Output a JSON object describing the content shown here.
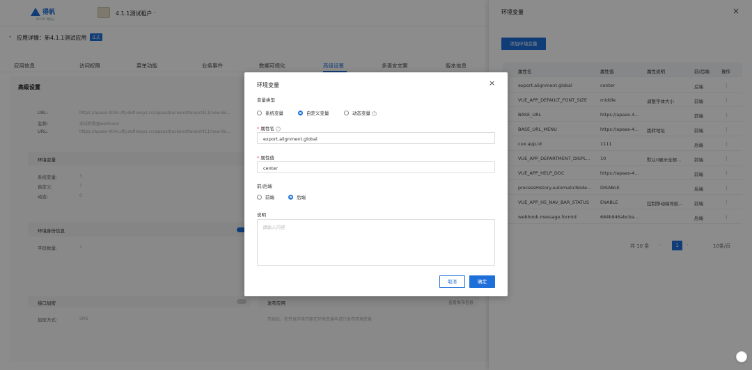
{
  "brand": {
    "logo_text": "得帆",
    "logo_sub": "DEFAN 得帆云",
    "tenant": "4.1.1测试租户"
  },
  "app": {
    "back_label": "‹",
    "title": "应用详情：新4.1.1测试应用",
    "badge": "正式"
  },
  "tabs": [
    "应用信息",
    "访问权限",
    "菜单功能",
    "业务事件",
    "数据可视化",
    "高级设置",
    "多语言文案",
    "版本信息"
  ],
  "card": {
    "title": "高级设置",
    "info": [
      {
        "k": "URL:",
        "v": "https://apaas-404n.dfy.definesys.cn/apaas/backend/tenant411/new-8u..."
      },
      {
        "k": "名称:",
        "v": "测试新数据webhook"
      },
      {
        "k": "URL:",
        "v": "https://apaas-404n.dfy.definesys.cn/apaas/backend/tenant411/new-8u..."
      }
    ],
    "env_title": "环境变量",
    "env": [
      {
        "k": "系统变量:",
        "v": "3"
      },
      {
        "k": "自定义:",
        "v": "7"
      },
      {
        "k": "动态:",
        "v": "0"
      }
    ],
    "identity_title": "环境身份信息",
    "identity": [
      {
        "k": "字段数量:",
        "v": "7"
      }
    ],
    "api_title": "接口加密",
    "api": [
      {
        "k": "加密方式:",
        "v": "SM2"
      }
    ],
    "publish_title": "发布应用",
    "publish_link": "查看发布信息",
    "publish_desc": "开启后，在开发环境只能在环境变量中进行发布环境变量"
  },
  "drawer": {
    "title": "环境变量",
    "close": "×",
    "add_button": "添加环境变量",
    "columns": [
      "属性名",
      "属性值",
      "属性说明",
      "前/后端",
      "操作"
    ],
    "rows": [
      {
        "name": "export.alignment.global",
        "value": "center",
        "desc": "",
        "side": "后端"
      },
      {
        "name": "VUE_APP_DEFAULT_FONT_SIZE",
        "value": "middle",
        "desc": "调整字体大小",
        "side": "前端"
      },
      {
        "name": "BASE_URL",
        "value": "https://apaas-4...",
        "desc": "",
        "side": "前端"
      },
      {
        "name": "BASE_URL_MENU",
        "value": "https://apaas-4...",
        "desc": "跳转地址",
        "side": "前端"
      },
      {
        "name": "cux.app.id",
        "value": "1111",
        "desc": "",
        "side": "后端"
      },
      {
        "name": "VUE_APP_DEPARTMENT_DISPL...",
        "value": "10",
        "desc": "默认0展示全部...",
        "side": "前端"
      },
      {
        "name": "VUE_APP_HELP_DOC",
        "value": "https://apaas-4...",
        "desc": "",
        "side": "前端"
      },
      {
        "name": "processHistory.automaticNode...",
        "value": "DISABLE",
        "desc": "",
        "side": "后端"
      },
      {
        "name": "VUE_APP_H5_NAV_BAR_STATUS",
        "value": "ENABLE",
        "desc": "控制移动端导航...",
        "side": "前端"
      },
      {
        "name": "webhook.message.formId",
        "value": "684b946abcba...",
        "desc": "",
        "side": "后端"
      }
    ],
    "row_action": "⋮",
    "pager": {
      "total": "共 10 条",
      "prev": "‹",
      "page": "1",
      "next": "›",
      "size": "10条/页"
    }
  },
  "modal": {
    "title": "环境变量",
    "close": "×",
    "type_label": "变量类型",
    "type_options": [
      "系统变量",
      "自定义变量",
      "动态变量"
    ],
    "type_selected": "自定义变量",
    "name_label": "属性名",
    "name_value": "export.alignment.global",
    "value_label": "属性值",
    "value_value": "center",
    "side_label": "前/后端",
    "side_options": [
      "前端",
      "后端"
    ],
    "side_selected": "后端",
    "desc_label": "说明",
    "desc_placeholder": "请输入内容",
    "cancel": "取消",
    "ok": "确定"
  },
  "colors": {
    "accent": "#1e6fd9"
  }
}
